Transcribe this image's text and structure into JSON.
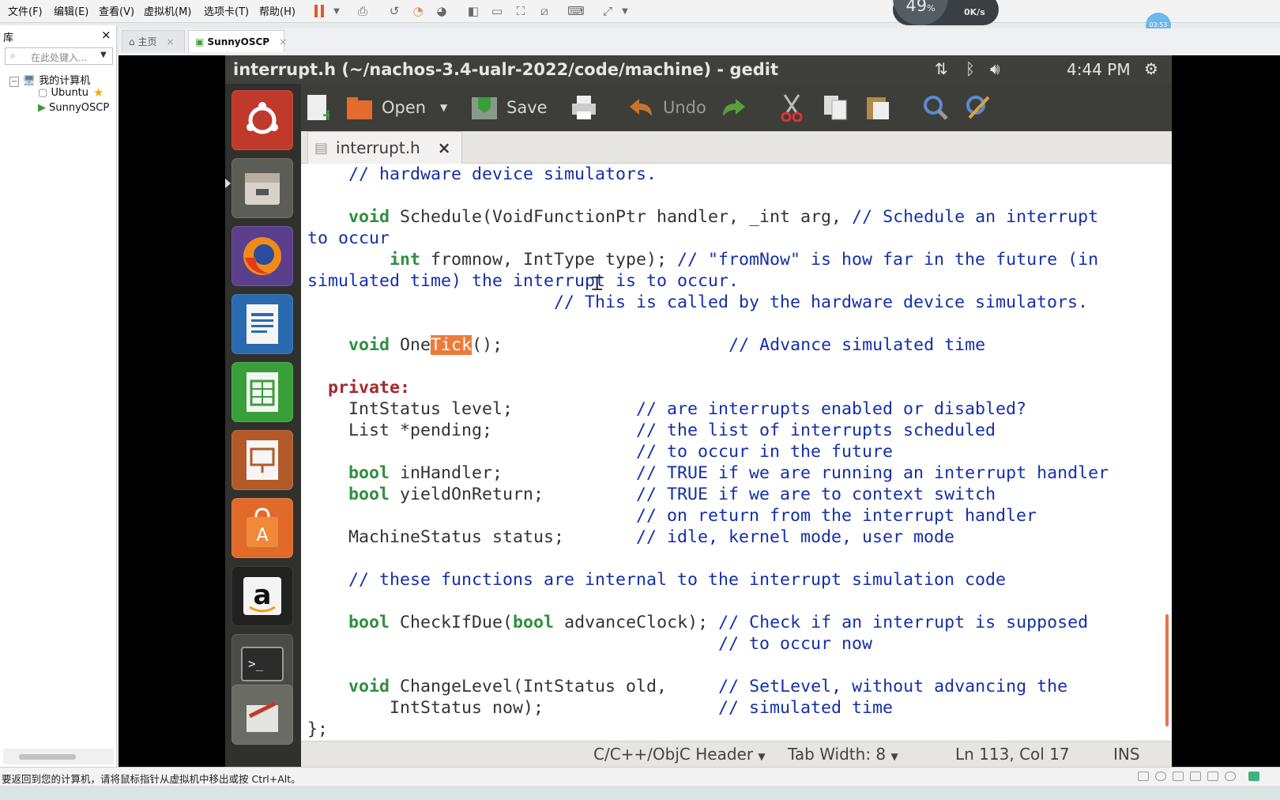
{
  "vmware": {
    "menu": [
      "文件(F)",
      "编辑(E)",
      "查看(V)",
      "虚拟机(M)",
      "选项卡(T)",
      "帮助(H)"
    ],
    "perf_percent": "49",
    "perf_percent_unit": "%",
    "net_speed": "0K/s",
    "timer": "03:53",
    "library_title": "库",
    "library_close": "×",
    "search_placeholder": "在此处键入...",
    "tree": {
      "root": "我的计算机",
      "items": [
        "Ubuntu",
        "SunnyOSCP"
      ]
    },
    "tabs": [
      {
        "label": "主页"
      },
      {
        "label": "SunnyOSCP"
      }
    ],
    "status_text": "要返回到您的计算机，请将鼠标指针从虚拟机中移出或按 Ctrl+Alt。"
  },
  "ubuntu": {
    "window_title": "interrupt.h (~/nachos-3.4-ualr-2022/code/machine) - gedit",
    "clock": "4:44 PM",
    "icons": [
      "network-icon",
      "bluetooth-icon",
      "volume-icon",
      "settings-gear-icon"
    ],
    "launcher": [
      "ubuntu-dash-icon",
      "files-icon",
      "firefox-icon",
      "writer-icon",
      "calc-icon",
      "impress-icon",
      "software-center-icon",
      "amazon-icon",
      "terminal-icon",
      "text-editor-icon"
    ]
  },
  "gedit": {
    "toolbar": {
      "open": "Open",
      "save": "Save",
      "undo": "Undo"
    },
    "tab_label": "interrupt.h",
    "tab_close": "×",
    "code_lines": [
      "    // hardware device simulators.",
      "",
      "    void Schedule(VoidFunctionPtr handler, _int arg, // Schedule an interrupt",
      "to occur",
      "        int fromnow, IntType type); // \"fromNow\" is how far in the future (in",
      "simulated time) the interrupt is to occur.",
      "                        // This is called by the hardware device simulators.",
      "",
      "    void OneTick();                      // Advance simulated time",
      "",
      "  private:",
      "    IntStatus level;            // are interrupts enabled or disabled?",
      "    List *pending;              // the list of interrupts scheduled",
      "                                // to occur in the future",
      "    bool inHandler;             // TRUE if we are running an interrupt handler",
      "    bool yieldOnReturn;         // TRUE if we are to context switch",
      "                                // on return from the interrupt handler",
      "    MachineStatus status;       // idle, kernel mode, user mode",
      "",
      "    // these functions are internal to the interrupt simulation code",
      "",
      "    bool CheckIfDue(bool advanceClock); // Check if an interrupt is supposed",
      "                                        // to occur now",
      "",
      "    void ChangeLevel(IntStatus old,     // SetLevel, without advancing the",
      "        IntStatus now);                 // simulated time",
      "};"
    ],
    "search_highlight": "Tick",
    "status": {
      "language": "C/C++/ObjC Header",
      "tab_width": "Tab Width: 8",
      "position": "Ln 113, Col 17",
      "mode": "INS"
    }
  },
  "colors": {
    "keyword": "#2f8f3f",
    "private_keyword": "#a5282a",
    "comment": "#1330a8",
    "highlight": "#ee7a3a",
    "panel": "#3f3f3b"
  }
}
